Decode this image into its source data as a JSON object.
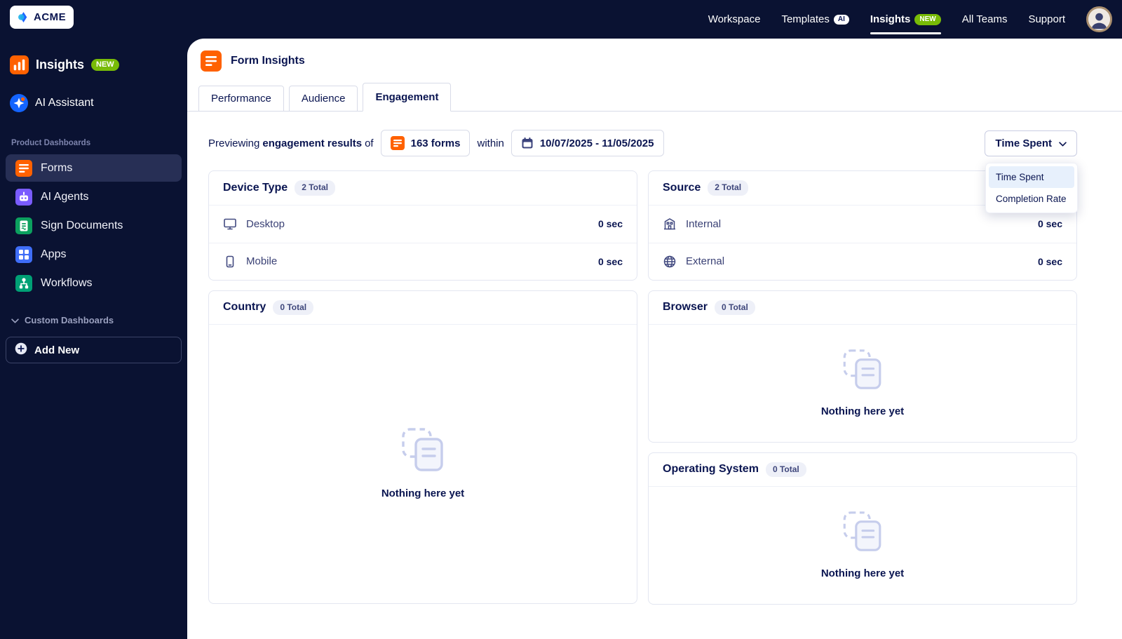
{
  "colors": {
    "navy": "#0a1232",
    "text_navy": "#0a1551",
    "accent_orange": "#ff6100",
    "badge_green": "#78bb07",
    "selected_option_bg": "#e7f0fc"
  },
  "topbar": {
    "logo": "ACME",
    "nav": [
      {
        "label": "Workspace"
      },
      {
        "label": "Templates",
        "badge": "AI"
      },
      {
        "label": "Insights",
        "badge": "NEW",
        "active": true
      },
      {
        "label": "All Teams"
      },
      {
        "label": "Support"
      }
    ]
  },
  "sidebar": {
    "insights": {
      "label": "Insights",
      "badge": "NEW",
      "icon": "insights-icon"
    },
    "ai_assistant": {
      "label": "AI Assistant",
      "icon": "ai-assistant-icon"
    },
    "section": "Product Dashboards",
    "items": [
      {
        "label": "Forms",
        "icon": "forms-icon",
        "active": true
      },
      {
        "label": "AI Agents",
        "icon": "ai-agents-icon"
      },
      {
        "label": "Sign Documents",
        "icon": "sign-documents-icon"
      },
      {
        "label": "Apps",
        "icon": "apps-icon"
      },
      {
        "label": "Workflows",
        "icon": "workflows-icon"
      }
    ],
    "custom_dashboards": "Custom Dashboards",
    "add_new": "Add New"
  },
  "page": {
    "title": "Form Insights",
    "icon": "form-insights-icon"
  },
  "tabs": [
    {
      "label": "Performance"
    },
    {
      "label": "Audience"
    },
    {
      "label": "Engagement",
      "active": true
    }
  ],
  "filter_bar": {
    "text_prefix": "Previewing",
    "text_bold": "engagement results",
    "text_of": "of",
    "forms_chip": "163 forms",
    "within": "within",
    "date_chip": "10/07/2025 - 11/05/2025"
  },
  "metric_dropdown": {
    "selected": "Time Spent",
    "options": [
      "Time Spent",
      "Completion Rate"
    ]
  },
  "cards": {
    "device_type": {
      "title": "Device Type",
      "count_badge": "2 Total",
      "rows": [
        {
          "label": "Desktop",
          "icon": "desktop-icon",
          "value": "0 sec"
        },
        {
          "label": "Mobile",
          "icon": "mobile-icon",
          "value": "0 sec"
        }
      ]
    },
    "source": {
      "title": "Source",
      "count_badge": "2 Total",
      "rows": [
        {
          "label": "Internal",
          "icon": "building-icon",
          "value": "0 sec"
        },
        {
          "label": "External",
          "icon": "globe-icon",
          "value": "0 sec"
        }
      ]
    },
    "country": {
      "title": "Country",
      "count_badge": "0 Total",
      "empty_text": "Nothing here yet"
    },
    "browser": {
      "title": "Browser",
      "count_badge": "0 Total",
      "empty_text": "Nothing here yet"
    },
    "operating_system": {
      "title": "Operating System",
      "count_badge": "0 Total",
      "empty_text": "Nothing here yet"
    }
  }
}
